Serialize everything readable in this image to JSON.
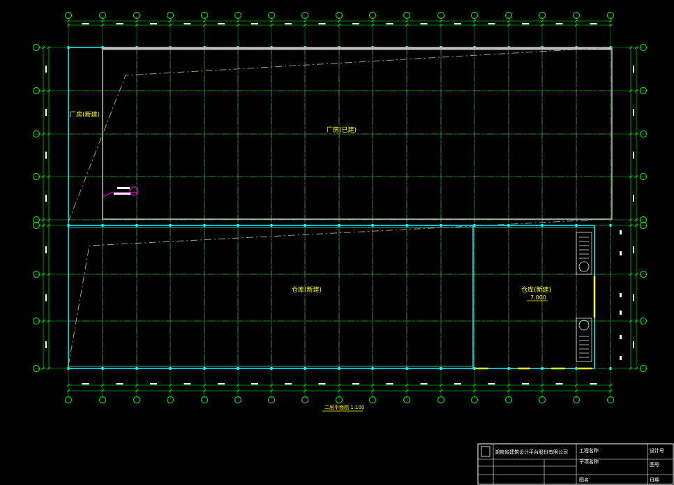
{
  "drawing": {
    "plan_title": "二层平面图 1:100",
    "rooms": [
      {
        "id": "factory-new",
        "label": "厂房(新建)"
      },
      {
        "id": "factory-existing",
        "label": "厂房(已建)"
      },
      {
        "id": "warehouse-new-large",
        "label": "仓库(新建)"
      },
      {
        "id": "warehouse-new-small",
        "label": "仓库(新建)"
      }
    ],
    "elevation": "7.000",
    "column_axes_count": 17,
    "row_axes_count": 8
  },
  "title_block": {
    "company": "湖南省建筑设计平台股份有限公司",
    "fields": [
      "工程名称",
      "子项名称",
      "图名"
    ],
    "right_fields": [
      "设计号",
      "图号",
      "日期"
    ]
  },
  "colors": {
    "background": "#000000",
    "axis_bubble": "#00ff00",
    "wall": "#00ffff",
    "grid_dash": "#9a9a9a",
    "text": "#ffff00",
    "accent": "#ff00ff"
  }
}
